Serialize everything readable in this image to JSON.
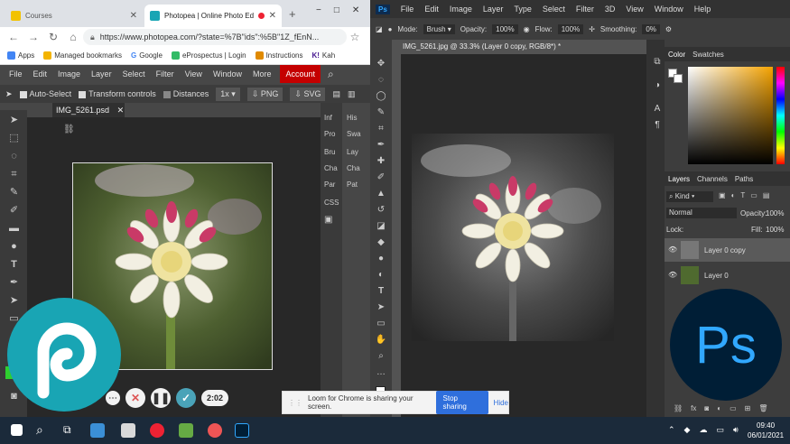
{
  "chrome": {
    "tabs": [
      {
        "label": "Courses"
      },
      {
        "label": "Photopea | Online Photo Edi"
      }
    ],
    "new_tab": "+",
    "window_controls": [
      "−",
      "□",
      "✕"
    ],
    "url": "https://www.photopea.com/?state=%7B\"ids\":%5B\"1Z_fEnN...",
    "bookmarks": [
      "Apps",
      "Managed bookmarks",
      "Google",
      "eProspectus | Login",
      "Instructions",
      "Kah"
    ]
  },
  "photopea": {
    "menu": [
      "File",
      "Edit",
      "Image",
      "Layer",
      "Select",
      "Filter",
      "View",
      "Window",
      "More",
      "Account"
    ],
    "options": {
      "auto_select": "Auto-Select",
      "transform_controls": "Transform controls",
      "distances": "Distances",
      "zoom": "1x",
      "png": "PNG",
      "svg": "SVG"
    },
    "doc_tab": "IMG_5261.psd",
    "side_col1": [
      "Inf",
      "Pro",
      "Bru",
      "Cha",
      "Par",
      "CSS"
    ],
    "side_col2": [
      "His",
      "Swa",
      "Lay",
      "Cha",
      "Pat"
    ]
  },
  "photoshop": {
    "app_badge": "Ps",
    "menu": [
      "File",
      "Edit",
      "Image",
      "Layer",
      "Type",
      "Select",
      "Filter",
      "3D",
      "View",
      "Window",
      "Help"
    ],
    "options": {
      "mode_label": "Mode:",
      "mode_value": "Brush",
      "opacity_label": "Opacity:",
      "opacity_value": "100%",
      "flow_label": "Flow:",
      "flow_value": "100%",
      "smoothing_label": "Smoothing:",
      "smoothing_value": "0%"
    },
    "doc_tab": "IMG_5261.jpg @ 33.3% (Layer 0 copy, RGB/8*) *",
    "color_tabs": [
      "Color",
      "Swatches"
    ],
    "layer_tabs": [
      "Layers",
      "Channels",
      "Paths"
    ],
    "kind": "Kind",
    "blend_mode": "Normal",
    "opacity_label": "Opacity:",
    "opacity_value": "100%",
    "lock_label": "Lock:",
    "fill_label": "Fill:",
    "fill_value": "100%",
    "layers": [
      "Layer 0 copy",
      "Layer 0"
    ],
    "logo_text": "Ps"
  },
  "loom": {
    "message": "Loom for Chrome is sharing your screen.",
    "stop": "Stop sharing",
    "hide": "Hide",
    "timer": "2:02"
  },
  "taskbar": {
    "time": "09:40",
    "date": "06/01/2021"
  }
}
